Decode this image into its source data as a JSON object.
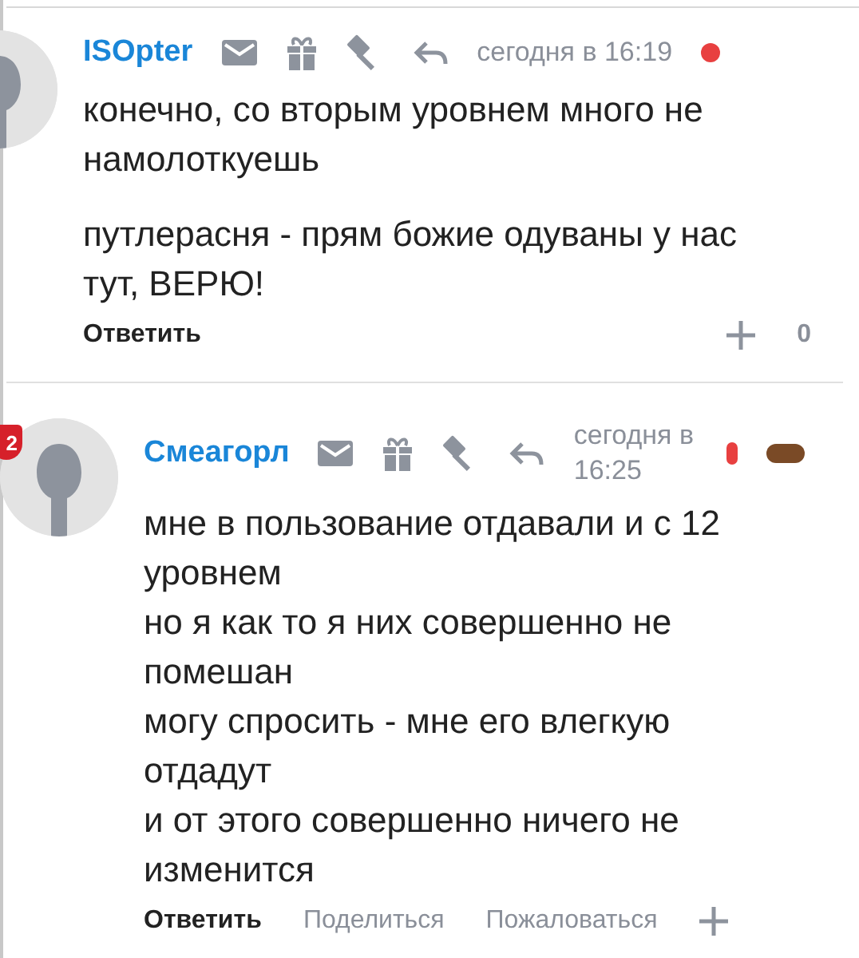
{
  "comments": [
    {
      "author": "ISOpter",
      "time": "сегодня в 16:19",
      "online": true,
      "paragraphs": [
        "конечно, со вторым уровнем много не намолоткуешь",
        "путлерасня - прям божие одуваны у нас тут, ВЕРЮ!"
      ],
      "actions": [
        "Ответить"
      ],
      "score": "0",
      "children": [
        {
          "author": "Смеагорл",
          "time": "сегодня в 16:25",
          "online": true,
          "badge": "2",
          "paragraphs": [
            "мне в пользование отдавали и с 12 уровнем\nно я как то я них совершенно не помешан\nмогу спросить - мне его влегкую отдадут\nи от этого совершенно ничего не изменится"
          ],
          "actions": [
            "Ответить",
            "Поделиться",
            "Пожаловаться"
          ],
          "sticker": true
        }
      ]
    }
  ]
}
